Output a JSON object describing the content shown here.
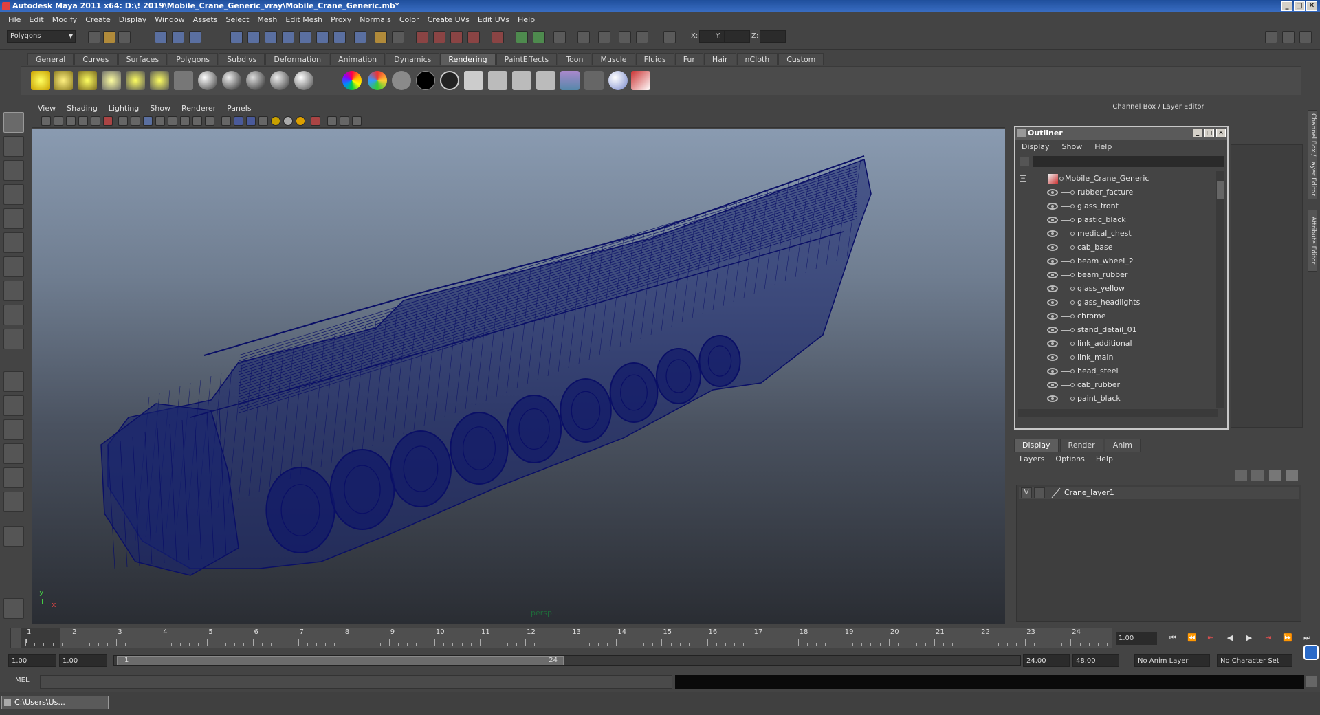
{
  "window": {
    "title": "Autodesk Maya 2011 x64: D:\\! 2019\\Mobile_Crane_Generic_vray\\Mobile_Crane_Generic.mb*"
  },
  "menubar": [
    "File",
    "Edit",
    "Modify",
    "Create",
    "Display",
    "Window",
    "Assets",
    "Select",
    "Mesh",
    "Edit Mesh",
    "Proxy",
    "Normals",
    "Color",
    "Create UVs",
    "Edit UVs",
    "Help"
  ],
  "status": {
    "menu_set": "Polygons",
    "x_label": "X:",
    "y_label": "Y:",
    "z_label": "Z:"
  },
  "shelf_tabs": [
    "General",
    "Curves",
    "Surfaces",
    "Polygons",
    "Subdivs",
    "Deformation",
    "Animation",
    "Dynamics",
    "Rendering",
    "PaintEffects",
    "Toon",
    "Muscle",
    "Fluids",
    "Fur",
    "Hair",
    "nCloth",
    "Custom"
  ],
  "shelf_active": "Rendering",
  "viewport": {
    "menus": [
      "View",
      "Shading",
      "Lighting",
      "Show",
      "Renderer",
      "Panels"
    ],
    "camera_label": "persp",
    "axis_y": "y",
    "axis_x": "x",
    "wire_color": "#0a0f66"
  },
  "right_panel": {
    "title": "Channel Box / Layer Editor",
    "side_tab_1": "Channel Box / Layer Editor",
    "side_tab_2": "Attribute Editor"
  },
  "outliner": {
    "title": "Outliner",
    "menus": [
      "Display",
      "Show",
      "Help"
    ],
    "root": "Mobile_Crane_Generic",
    "items": [
      "rubber_facture",
      "glass_front",
      "plastic_black",
      "medical_chest",
      "cab_base",
      "beam_wheel_2",
      "beam_rubber",
      "glass_yellow",
      "glass_headlights",
      "chrome",
      "stand_detail_01",
      "link_additional",
      "link_main",
      "head_steel",
      "cab_rubber",
      "paint_black"
    ]
  },
  "layer_editor": {
    "tabs": [
      "Display",
      "Render",
      "Anim"
    ],
    "active_tab": "Display",
    "menus": [
      "Layers",
      "Options",
      "Help"
    ],
    "layer": {
      "visible": "V",
      "name": "Crane_layer1"
    }
  },
  "timeline": {
    "ticks": [
      "1",
      "2",
      "3",
      "4",
      "5",
      "6",
      "7",
      "8",
      "9",
      "10",
      "11",
      "12",
      "13",
      "14",
      "15",
      "16",
      "17",
      "18",
      "19",
      "20",
      "21",
      "22",
      "23",
      "24"
    ],
    "current_frame": "1.00",
    "marker": "1"
  },
  "range": {
    "start_time": "1.00",
    "playback_start": "1.00",
    "slider_start": "1",
    "slider_end": "24",
    "playback_end": "24.00",
    "end_time": "48.00",
    "anim_layer": "No Anim Layer",
    "character_set": "No Character Set"
  },
  "command_line": {
    "label": "MEL"
  },
  "taskbar": {
    "minimized_window": "C:\\Users\\Us..."
  }
}
